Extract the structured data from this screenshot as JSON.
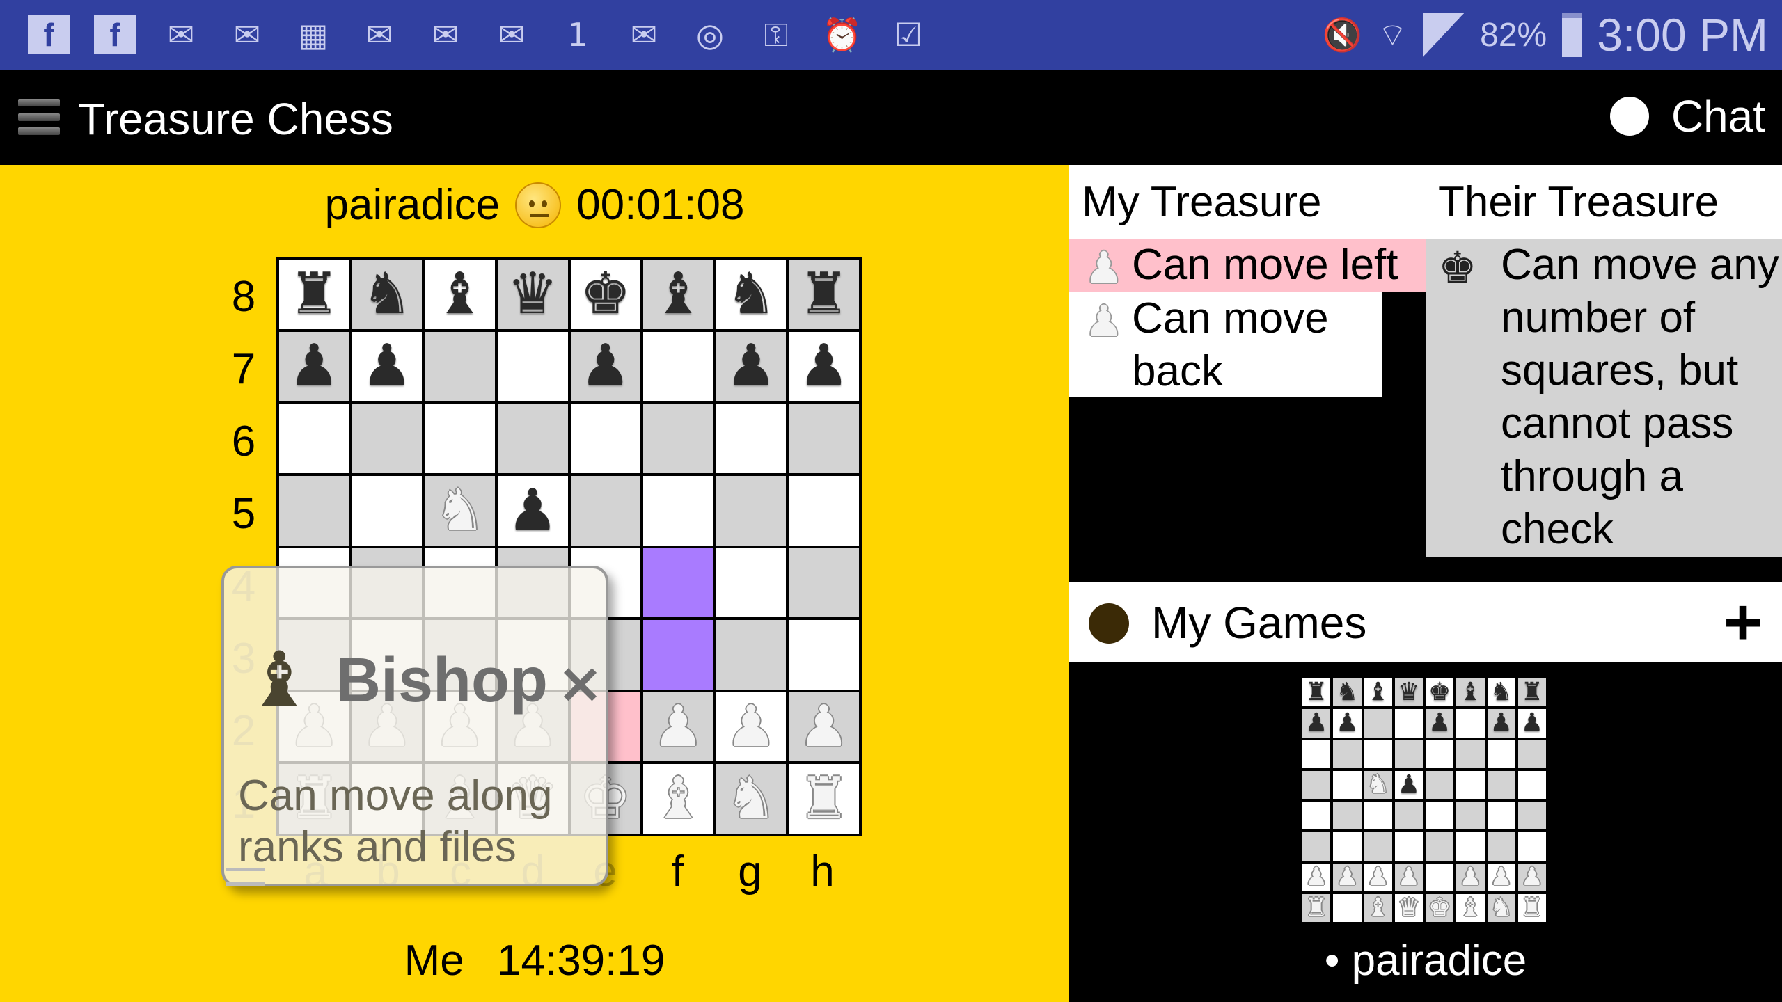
{
  "status_bar": {
    "notification_icons": [
      {
        "name": "facebook-icon",
        "glyph": "f"
      },
      {
        "name": "facebook-icon",
        "glyph": "f"
      },
      {
        "name": "email-icon",
        "glyph": "✉"
      },
      {
        "name": "email-icon",
        "glyph": "✉"
      },
      {
        "name": "calendar-icon",
        "glyph": "▦"
      },
      {
        "name": "email-icon",
        "glyph": "✉"
      },
      {
        "name": "email-icon",
        "glyph": "✉"
      },
      {
        "name": "voicemail-icon",
        "glyph": "✉"
      },
      {
        "name": "calendar-day-icon",
        "glyph": "1"
      },
      {
        "name": "email-icon",
        "glyph": "✉"
      },
      {
        "name": "sync-icon",
        "glyph": "◎"
      },
      {
        "name": "t-mobile-icon",
        "glyph": "⚿"
      },
      {
        "name": "alarm-icon",
        "glyph": "⏰"
      },
      {
        "name": "clipboard-check-icon",
        "glyph": "☑"
      }
    ],
    "battery": "82%",
    "time": "3:00 PM",
    "color": "#3140a0"
  },
  "app_bar": {
    "title": "Treasure Chess",
    "chat_label": "Chat"
  },
  "game": {
    "opponent": "pairadice",
    "opponent_clock": "00:01:08",
    "me_label": "Me",
    "me_clock": "14:39:19",
    "ranks": [
      "8",
      "7",
      "6",
      "5",
      "4",
      "3",
      "2",
      "1"
    ],
    "files": [
      "a",
      "b",
      "c",
      "d",
      "e",
      "f",
      "g",
      "h"
    ],
    "board": [
      "rnbqkbnr",
      "pp..p.pp",
      "........",
      "..Np....",
      "........",
      "........",
      "PPPP.PPP",
      "R.BQKBNR"
    ],
    "highlights": [
      {
        "square": "f4",
        "color": "#a97bff"
      },
      {
        "square": "f3",
        "color": "#a97bff"
      },
      {
        "square": "e2",
        "color": "#ffc0cb"
      }
    ],
    "colors": {
      "light": "#ffffff",
      "dark": "#d3d3d3",
      "background": "#ffd600"
    }
  },
  "popup": {
    "piece": "b",
    "title": "Bishop",
    "close": "×",
    "description": "Can move along ranks and files"
  },
  "treasure": {
    "my_header": "My Treasure",
    "their_header": "Their Treasure",
    "mine": [
      {
        "piece": "pawn-white",
        "text": "Can move left",
        "selected": true
      },
      {
        "piece": "pawn-white",
        "text": "Can move back",
        "selected": false
      }
    ],
    "theirs": [
      {
        "piece": "king-black",
        "text": "Can move any number of squares, but cannot pass through a check"
      }
    ]
  },
  "my_games": {
    "label": "My Games",
    "add": "+",
    "games": [
      {
        "opponent": "• pairadice",
        "board": [
          "rnbqkbnr",
          "pp..p.pp",
          "........",
          "..Np....",
          "........",
          "........",
          "PPPP.PPP",
          "R.BQKBNR"
        ]
      }
    ]
  }
}
